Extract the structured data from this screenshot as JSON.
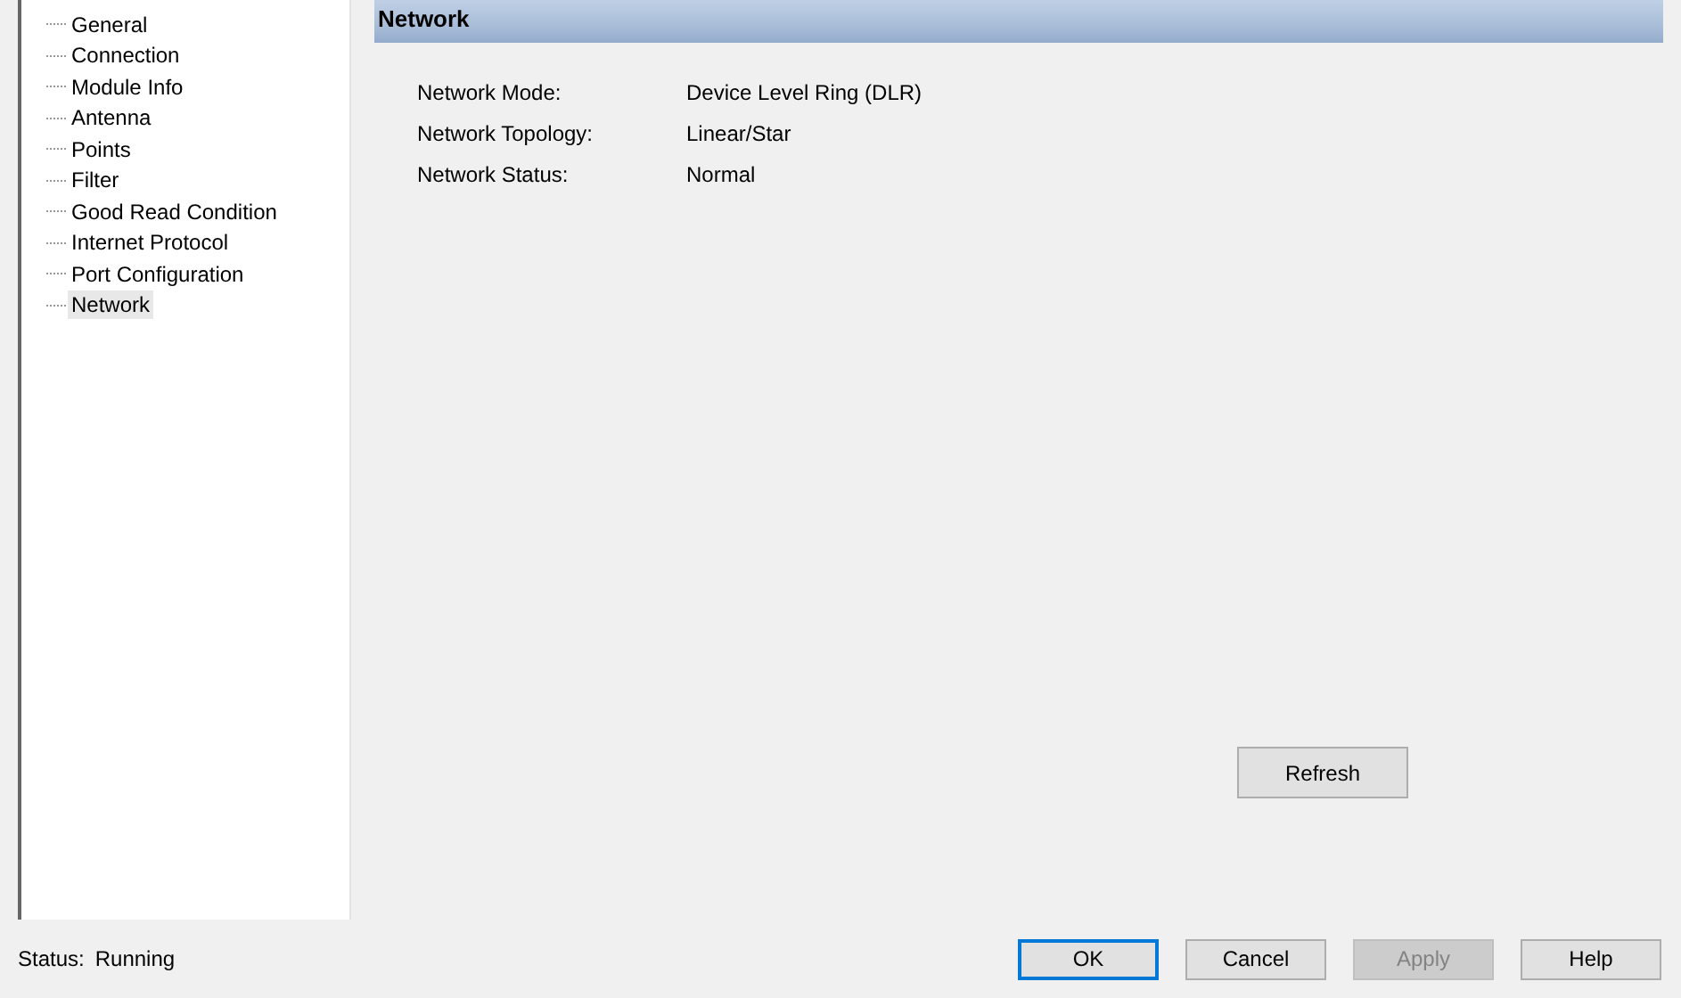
{
  "tree": {
    "items": [
      {
        "label": "General",
        "selected": false
      },
      {
        "label": "Connection",
        "selected": false
      },
      {
        "label": "Module Info",
        "selected": false
      },
      {
        "label": "Antenna",
        "selected": false
      },
      {
        "label": "Points",
        "selected": false
      },
      {
        "label": "Filter",
        "selected": false
      },
      {
        "label": "Good Read Condition",
        "selected": false
      },
      {
        "label": "Internet Protocol",
        "selected": false
      },
      {
        "label": "Port Configuration",
        "selected": false
      },
      {
        "label": "Network",
        "selected": true
      }
    ]
  },
  "panel": {
    "title": "Network",
    "fields": [
      {
        "label": "Network Mode:",
        "value": "Device Level Ring (DLR)"
      },
      {
        "label": "Network Topology:",
        "value": "Linear/Star"
      },
      {
        "label": "Network Status:",
        "value": "Normal"
      }
    ],
    "refresh_button": "Refresh"
  },
  "status_bar": {
    "label": "Status:",
    "value": "Running"
  },
  "buttons": [
    {
      "label": "OK",
      "default": true,
      "disabled": false
    },
    {
      "label": "Cancel",
      "default": false,
      "disabled": false
    },
    {
      "label": "Apply",
      "default": false,
      "disabled": true
    },
    {
      "label": "Help",
      "default": false,
      "disabled": false
    }
  ]
}
